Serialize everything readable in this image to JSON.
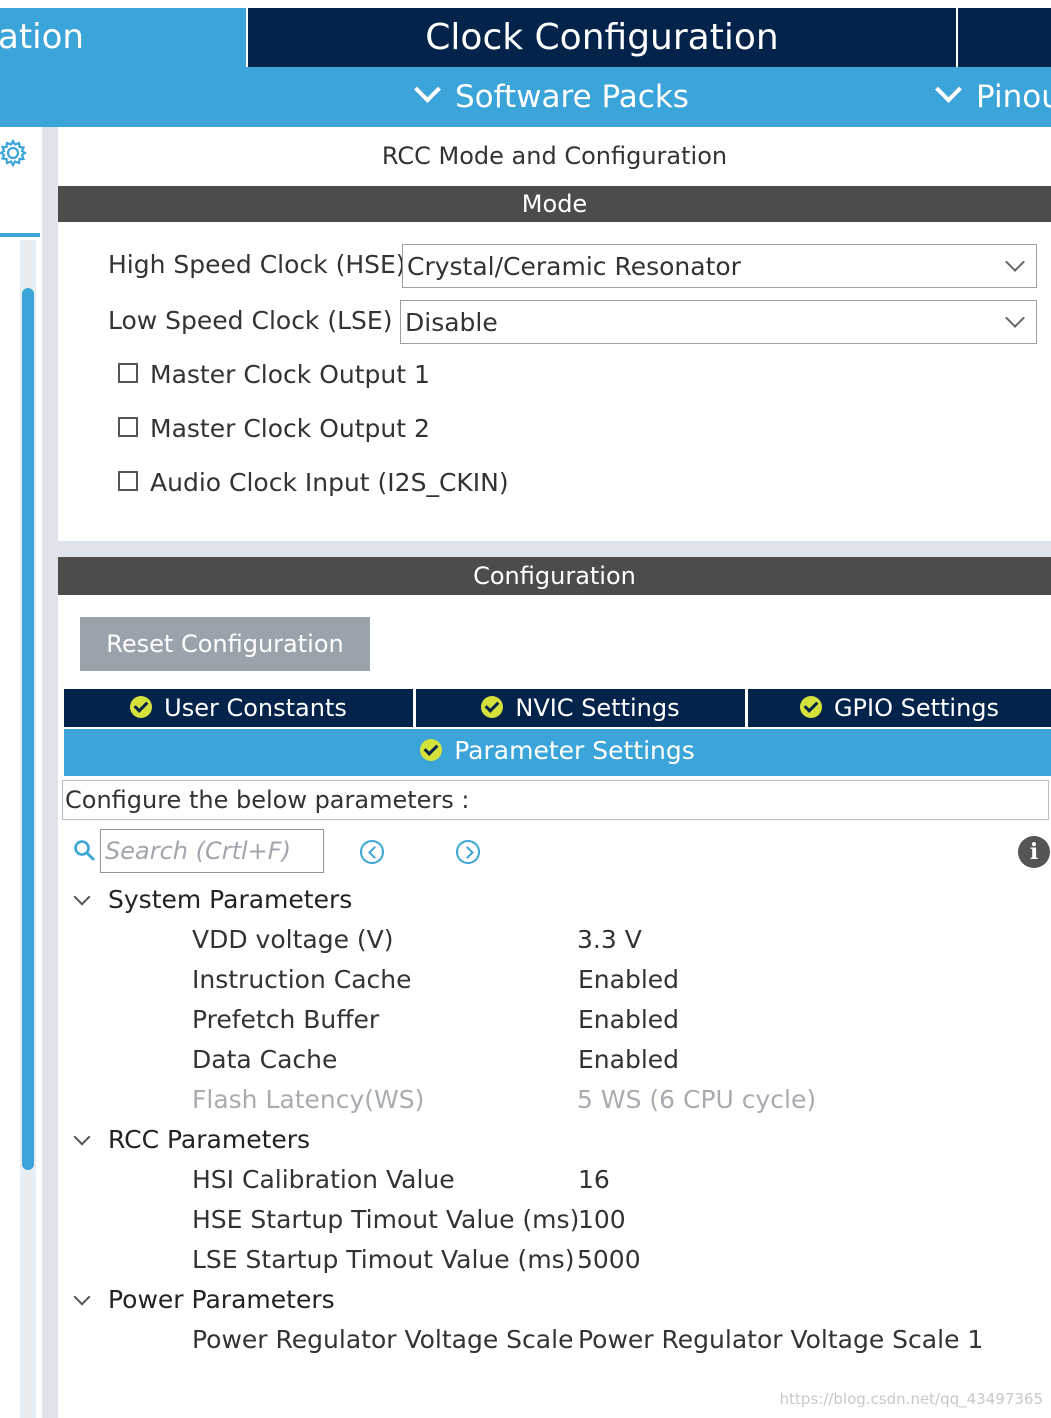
{
  "header": {
    "left_tab_label": "ation",
    "center_tab_label": "Clock Configuration",
    "software_packs_label": "Software Packs",
    "pinout_label": "Pinou"
  },
  "rcc_panel": {
    "title": "RCC Mode and Configuration",
    "mode_section": "Mode",
    "hse_label": "High Speed Clock (HSE)",
    "hse_value": "Crystal/Ceramic Resonator",
    "lse_label": "Low Speed Clock (LSE)",
    "lse_value": "Disable",
    "checkboxes": [
      {
        "label": "Master Clock Output 1",
        "checked": false
      },
      {
        "label": "Master Clock Output 2",
        "checked": false
      },
      {
        "label": "Audio Clock Input (I2S_CKIN)",
        "checked": false
      }
    ],
    "configuration_section": "Configuration",
    "reset_button": "Reset Configuration"
  },
  "tabs": {
    "user_constants": "User Constants",
    "nvic_settings": "NVIC Settings",
    "gpio_settings": "GPIO Settings",
    "parameter_settings": "Parameter Settings"
  },
  "params": {
    "configure_hint": "Configure the below parameters :",
    "search_placeholder": "Search (Crtl+F)",
    "groups": [
      {
        "name": "System Parameters",
        "items": [
          {
            "name": "VDD voltage (V)",
            "value": "3.3 V"
          },
          {
            "name": "Instruction Cache",
            "value": "Enabled"
          },
          {
            "name": "Prefetch Buffer",
            "value": "Enabled"
          },
          {
            "name": "Data Cache",
            "value": "Enabled"
          },
          {
            "name": "Flash Latency(WS)",
            "value": "5 WS (6 CPU cycle)"
          }
        ]
      },
      {
        "name": "RCC Parameters",
        "items": [
          {
            "name": "HSI Calibration Value",
            "value": "16"
          },
          {
            "name": "HSE Startup Timout Value (ms)",
            "value": "100"
          },
          {
            "name": "LSE Startup Timout Value (ms)",
            "value": "5000"
          }
        ]
      },
      {
        "name": "Power Parameters",
        "items": [
          {
            "name": "Power Regulator Voltage Scale",
            "value": "Power Regulator Voltage Scale 1"
          }
        ]
      }
    ]
  },
  "watermark": "https://blog.csdn.net/qq_43497365",
  "colors": {
    "accent_blue": "#3ba4d8",
    "navy": "#03234b",
    "section_gray": "#4c4c4c",
    "check_yellow": "#d6e23c"
  }
}
